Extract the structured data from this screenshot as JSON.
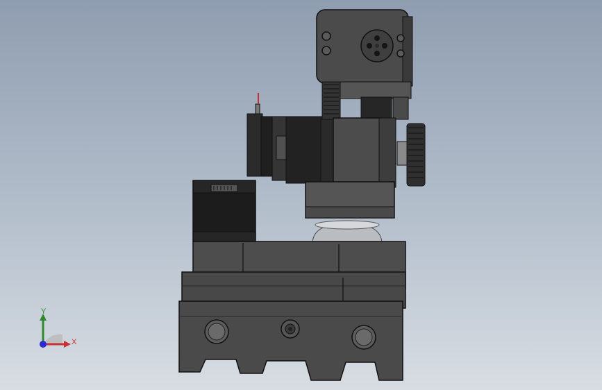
{
  "viewport": {
    "background_top": "#8f9db0",
    "background_bottom": "#d8dde3"
  },
  "model": {
    "part_color": "#4a4a4a",
    "part_dark": "#2a2a2a",
    "part_light": "#666666",
    "motor_color": "#202020",
    "edge_color": "#111111"
  },
  "triad": {
    "y_label": "Y",
    "x_label": "X",
    "y_color": "#2f8a2f",
    "x_color": "#c83232",
    "z_color": "#2a2ad0"
  }
}
